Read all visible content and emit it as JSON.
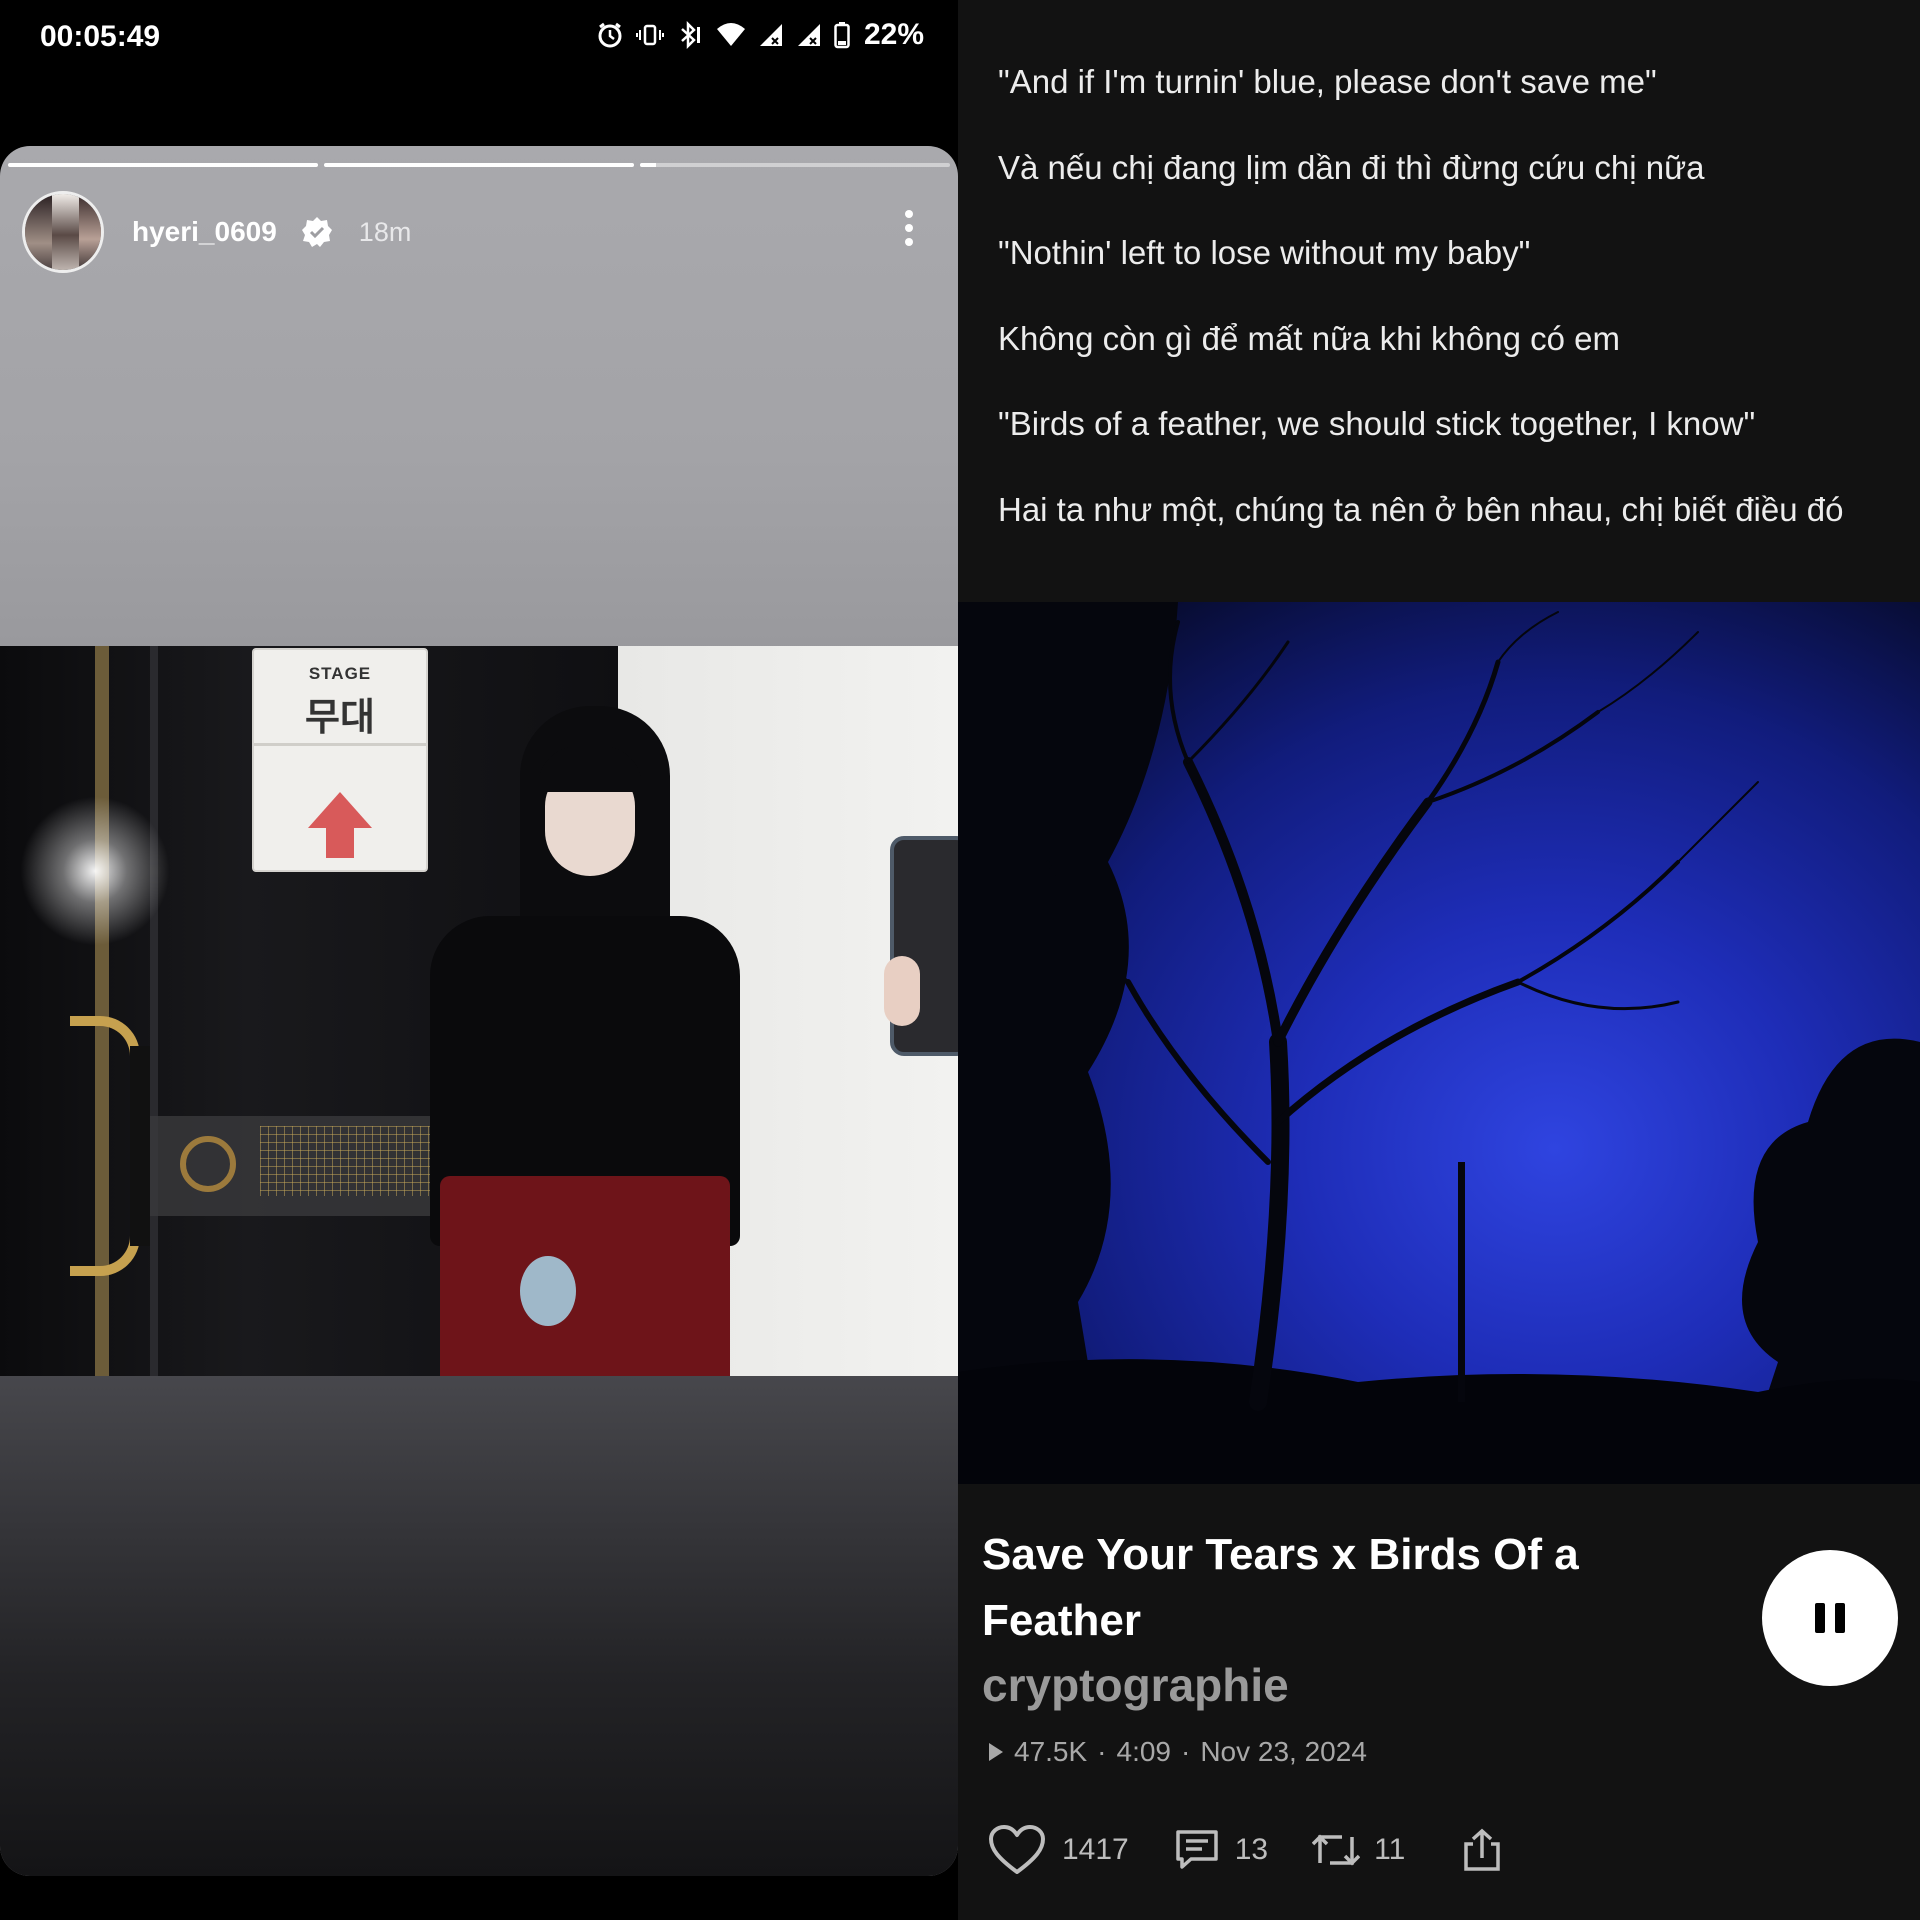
{
  "status_bar": {
    "time": "00:05:49",
    "battery": "22%",
    "icons": [
      "alarm-icon",
      "vibrate-icon",
      "bluetooth-icon",
      "wifi-icon",
      "signal-icon",
      "signal-icon",
      "battery-icon"
    ]
  },
  "story": {
    "username": "hyeri_0609",
    "verified": true,
    "time_ago": "18m",
    "progress_fraction": [
      1.0,
      1.0,
      0.05
    ],
    "photo_sign": {
      "english": "STAGE",
      "korean": "무대"
    }
  },
  "music": {
    "lyrics": [
      "\"And if I'm turnin' blue, please don't save me\"",
      "Và nếu chị đang lịm dần đi thì đừng cứu chị nữa",
      "\"Nothin' left to lose without my baby\"",
      "Không còn gì để mất nữa khi không có em",
      "\"Birds of a feather, we should stick together, I know\"",
      "Hai ta như một, chúng ta nên ở bên nhau, chị biết điều đó"
    ],
    "title": "Save Your Tears x Birds Of a Feather",
    "artist": "cryptographie",
    "plays": "47.5K",
    "duration": "4:09",
    "date": "Nov 23, 2024",
    "separator": "·",
    "likes": "1417",
    "comments": "13",
    "reposts": "11",
    "playing": true
  },
  "colors": {
    "accent": "#ffffff",
    "music_bg": "#121212",
    "cover_blue": "#1a2aa8"
  }
}
